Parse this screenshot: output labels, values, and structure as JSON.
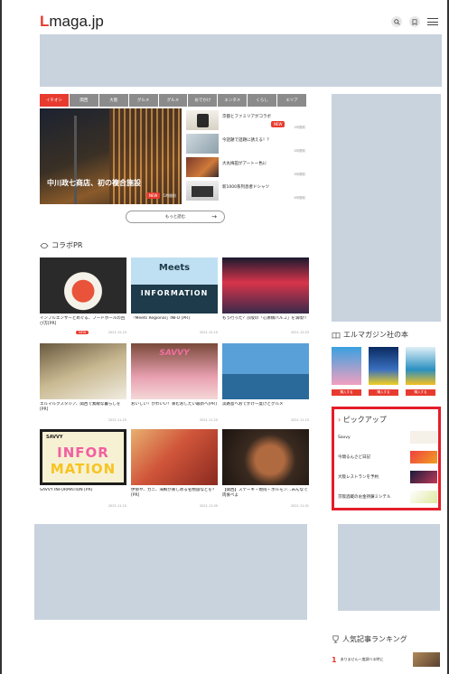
{
  "header": {
    "logo_l": "L",
    "logo_rest": "maga.jp",
    "icons": [
      "search-icon",
      "bookmark-icon",
      "menu-icon"
    ]
  },
  "tabs": [
    "イチオシ",
    "関西",
    "大阪",
    "グルメ",
    "グルメ",
    "おでかけ",
    "エンタメ",
    "くらし",
    "エリア"
  ],
  "hero": {
    "title": "中川政七商店、初の複合施設",
    "badge": "NEW",
    "date": "1時間前"
  },
  "news": [
    {
      "text": "京都とファミリアがコラボ",
      "badge": "NEW",
      "date": "1時間前"
    },
    {
      "text": "今話題で話題に誘える！？",
      "date": "2時間前"
    },
    {
      "text": "大丸梅田がアートー色に",
      "date": "3時間前"
    },
    {
      "text": "新1000系列息者ドシャツ",
      "date": "4時間前"
    }
  ],
  "more_button": "もっと読む",
  "collab": {
    "title": "コラボPR",
    "cards": [
      {
        "caption": "インフルエンサーとめぐる、フードホールの回び方[PR]",
        "pr": "NEW",
        "date": "2021.12.15"
      },
      {
        "caption": "「Meets Regional」INFO [PR]",
        "date": "2021.12.10",
        "img_top": "Meets",
        "img_bottom": "INFORMATION"
      },
      {
        "caption": "もう行った？京阪の「心斎橋パルコ」を満喫!!",
        "date": "2021.12.03"
      },
      {
        "caption": "エルマルクスタジア、関西で素敵な暮らしを[PR]",
        "date": "2021.11.25"
      },
      {
        "caption": "おいしい！かわいい！楽むおしたい最新へ[PR]",
        "date": "2021.11.20",
        "img_top": "SAVVY"
      },
      {
        "caption": "淡路島へおでかけ一度けとグルメ",
        "date": "2021.11.15"
      },
      {
        "caption": "SAVVY INFORMATION [PR]",
        "date": "2021.11.10",
        "img_top": "SAVVY",
        "img_line1": "INFOR",
        "img_line2": "MATION"
      },
      {
        "caption": "伊勢や、カニ、海鮮が楽しめる名物旅などを？[PR]",
        "date": "2021.11.05"
      },
      {
        "caption": "【関西】ステーキ・焼肉・ホルモン…みんなで肉食べよ",
        "date": "2021.11.01"
      }
    ]
  },
  "books": {
    "title": "エルマガジン社の本",
    "button": "購入する"
  },
  "pickup": {
    "title": "ピックアップ",
    "items": [
      "Savvy",
      "今間るんさど日記",
      "大阪レストランを予約",
      "京阪酒蔵のお金持錬ミシテル"
    ]
  },
  "ranking": {
    "title": "人気記事ランキング",
    "first_num": "1",
    "first_text": "ありません一度調べる時に"
  }
}
